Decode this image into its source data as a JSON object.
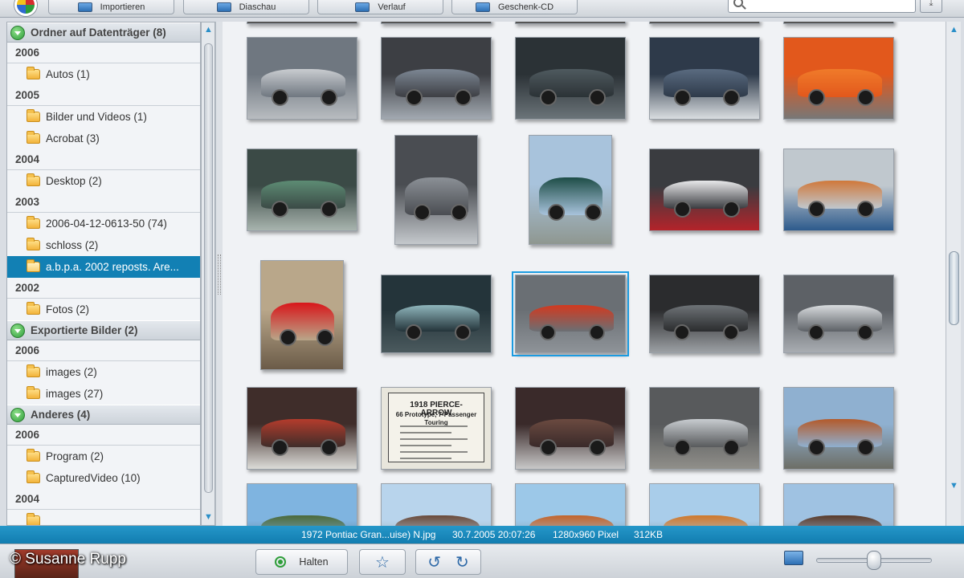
{
  "toolbar": {
    "buttons": [
      {
        "label": "Importieren",
        "icon": "camera-import-icon"
      },
      {
        "label": "Diaschau",
        "icon": "slideshow-icon"
      },
      {
        "label": "Verlauf",
        "icon": "timeline-icon"
      },
      {
        "label": "Geschenk-CD",
        "icon": "gift-cd-icon"
      }
    ],
    "search_placeholder": ""
  },
  "sidebar": {
    "groups": [
      {
        "title": "Ordner auf Datenträger (8)",
        "sections": [
          {
            "year": "2006",
            "folders": [
              "Autos (1)"
            ]
          },
          {
            "year": "2005",
            "folders": [
              "Bilder und Videos (1)",
              "Acrobat (3)"
            ]
          },
          {
            "year": "2004",
            "folders": [
              "Desktop (2)"
            ]
          },
          {
            "year": "2003",
            "folders": [
              "2006-04-12-0613-50 (74)",
              "schloss (2)",
              "a.b.p.a. 2002 reposts. Are..."
            ]
          },
          {
            "year": "2002",
            "folders": [
              "Fotos (2)"
            ]
          }
        ]
      },
      {
        "title": "Exportierte Bilder (2)",
        "sections": [
          {
            "year": "2006",
            "folders": [
              "images (2)",
              "images (27)"
            ]
          }
        ]
      },
      {
        "title": "Anderes (4)",
        "sections": [
          {
            "year": "2006",
            "folders": [
              "Program (2)",
              "CapturedVideo (10)"
            ]
          },
          {
            "year": "2004",
            "folders": []
          }
        ]
      }
    ],
    "selected_folder": "a.b.p.a. 2002 reposts. Are..."
  },
  "document_thumb": {
    "title": "1918 PIERCE-ARROW",
    "subtitle": "66 Prototype, 7-Passenger Touring"
  },
  "status": {
    "filename": "1972 Pontiac Gran...uise) N.jpg",
    "datetime": "30.7.2005 20:07:26",
    "dimensions": "1280x960 Pixel",
    "size": "312KB"
  },
  "bottombar": {
    "halten_label": "Halten",
    "copyright": "© Susanne Rupp",
    "zoom_level": 0.5
  },
  "colors": {
    "accent": "#1280b4",
    "statusbar": "#1a8cc0",
    "selection_outline": "#1b9be0",
    "group_toggle": "#2f9e3a"
  }
}
